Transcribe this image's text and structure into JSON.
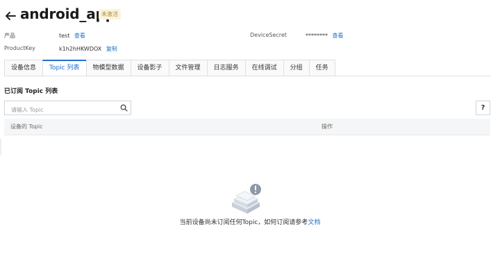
{
  "header": {
    "title": "android_app",
    "status": "未激活"
  },
  "meta": {
    "product_label": "产品",
    "product_value": "test",
    "product_link": "查看",
    "productkey_label": "ProductKey",
    "productkey_value": "k1h2hHKWDOX",
    "productkey_link": "复制",
    "devicesecret_label": "DeviceSecret",
    "devicesecret_value": "********",
    "devicesecret_link": "查看"
  },
  "tabs": [
    {
      "label": "设备信息"
    },
    {
      "label": "Topic 列表"
    },
    {
      "label": "物模型数据"
    },
    {
      "label": "设备影子"
    },
    {
      "label": "文件管理"
    },
    {
      "label": "日志服务"
    },
    {
      "label": "在线调试"
    },
    {
      "label": "分组"
    },
    {
      "label": "任务"
    }
  ],
  "active_tab": "Topic 列表",
  "section_title": "已订阅 Topic 列表",
  "search": {
    "placeholder": "请输入 Topic"
  },
  "help_label": "?",
  "table": {
    "columns": [
      "设备的 Topic",
      "操作"
    ]
  },
  "empty": {
    "text": "当前设备尚未订阅任何Topic，如何订阅请参考",
    "link": "文档"
  },
  "colors": {
    "accent": "#1f6fd1",
    "badge_bg": "#fbf3e0",
    "badge_text": "#b28a30"
  },
  "icons": [
    "arrow-left-icon",
    "search-icon",
    "help-icon",
    "empty-box-icon"
  ]
}
